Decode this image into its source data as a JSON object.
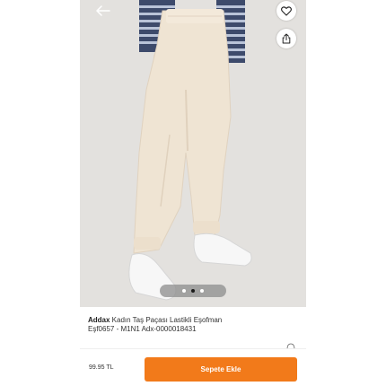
{
  "header": {
    "back_icon": "arrow-left-icon",
    "favorite_icon": "heart-icon",
    "share_icon": "share-icon"
  },
  "gallery": {
    "image_subject": "product-photo",
    "dot_count": 3,
    "active_dot": 2
  },
  "product": {
    "brand": "Addax",
    "name": " Kadın Taş Paçası Lastikli Eşofman",
    "code": "Eşf0657 - M1N1 Adx-0000018431"
  },
  "footer": {
    "price": "99.95 TL",
    "cart_label": "Sepete Ekle"
  },
  "colors": {
    "accent": "#f27a1a",
    "text": "#333333",
    "background": "#ffffff"
  }
}
